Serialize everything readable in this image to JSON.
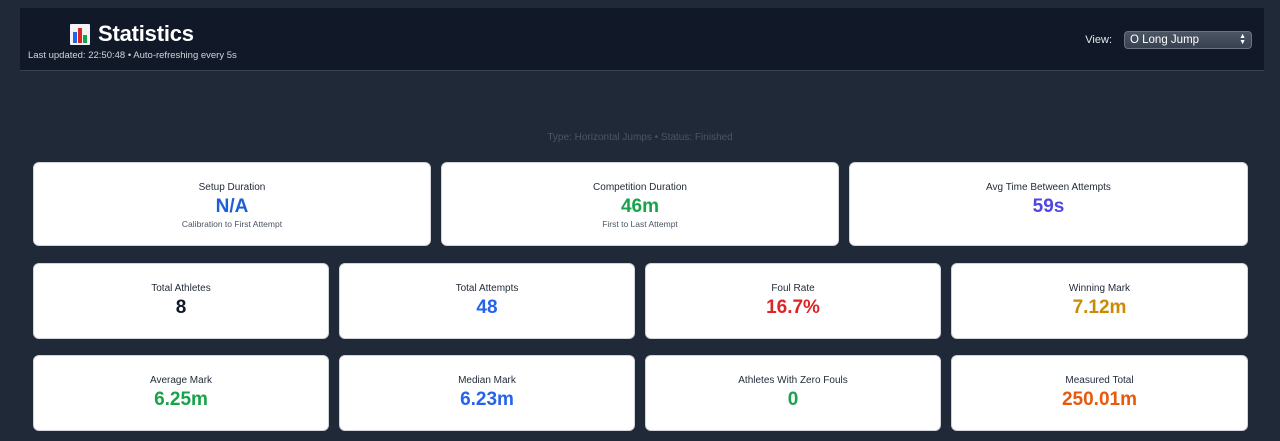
{
  "header": {
    "title": "Statistics",
    "last_updated": "Last updated: 22:50:48 • Auto-refreshing every 5s",
    "view_label": "View:",
    "view_selected": "O Long Jump",
    "icon": "bar-chart-icon"
  },
  "meta": {
    "line": "Type: Horizontal Jumps • Status: Finished"
  },
  "timing": [
    {
      "label": "Setup Duration",
      "value": "N/A",
      "note": "Calibration to First Attempt",
      "color": "#1d5fd8"
    },
    {
      "label": "Competition Duration",
      "value": "46m",
      "note": "First to Last Attempt",
      "color": "#16a34a"
    },
    {
      "label": "Avg Time Between Attempts",
      "value": "59s",
      "note": "",
      "color": "#4f46e5"
    }
  ],
  "stats_row1": [
    {
      "label": "Total Athletes",
      "value": "8",
      "color": "#111827"
    },
    {
      "label": "Total Attempts",
      "value": "48",
      "color": "#2563eb"
    },
    {
      "label": "Foul Rate",
      "value": "16.7%",
      "color": "#dc2626"
    },
    {
      "label": "Winning Mark",
      "value": "7.12m",
      "color": "#ca8a04"
    }
  ],
  "stats_row2": [
    {
      "label": "Average Mark",
      "value": "6.25m",
      "color": "#16a34a"
    },
    {
      "label": "Median Mark",
      "value": "6.23m",
      "color": "#2563eb"
    },
    {
      "label": "Athletes With Zero Fouls",
      "value": "0",
      "color": "#16a34a"
    },
    {
      "label": "Measured Total",
      "value": "250.01m",
      "color": "#ea580c"
    }
  ]
}
